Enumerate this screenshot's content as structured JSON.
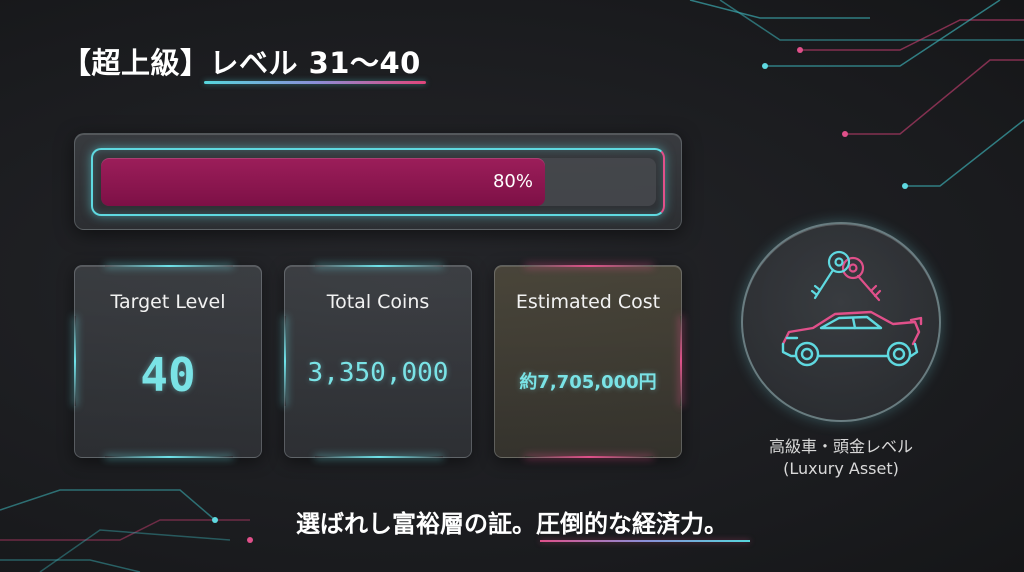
{
  "title": "【超上級】レベル 31〜40",
  "progress": {
    "percent": 80,
    "label": "80%"
  },
  "cards": [
    {
      "label": "Target Level",
      "value": "40"
    },
    {
      "label": "Total Coins",
      "value": "3,350,000"
    },
    {
      "label": "Estimated Cost",
      "value": "約7,705,000円"
    }
  ],
  "badge": {
    "caption_line1": "高級車・頭金レベル",
    "caption_line2": "(Luxury Asset)",
    "icons": [
      "keys-icon",
      "sports-car-icon"
    ]
  },
  "tagline": "選ばれし富裕層の証。圧倒的な経済力。",
  "colors": {
    "cyan": "#5fd9e0",
    "magenta": "#e0508a",
    "progress_fill": "#8a1650",
    "value_text": "#7ae3e6"
  }
}
